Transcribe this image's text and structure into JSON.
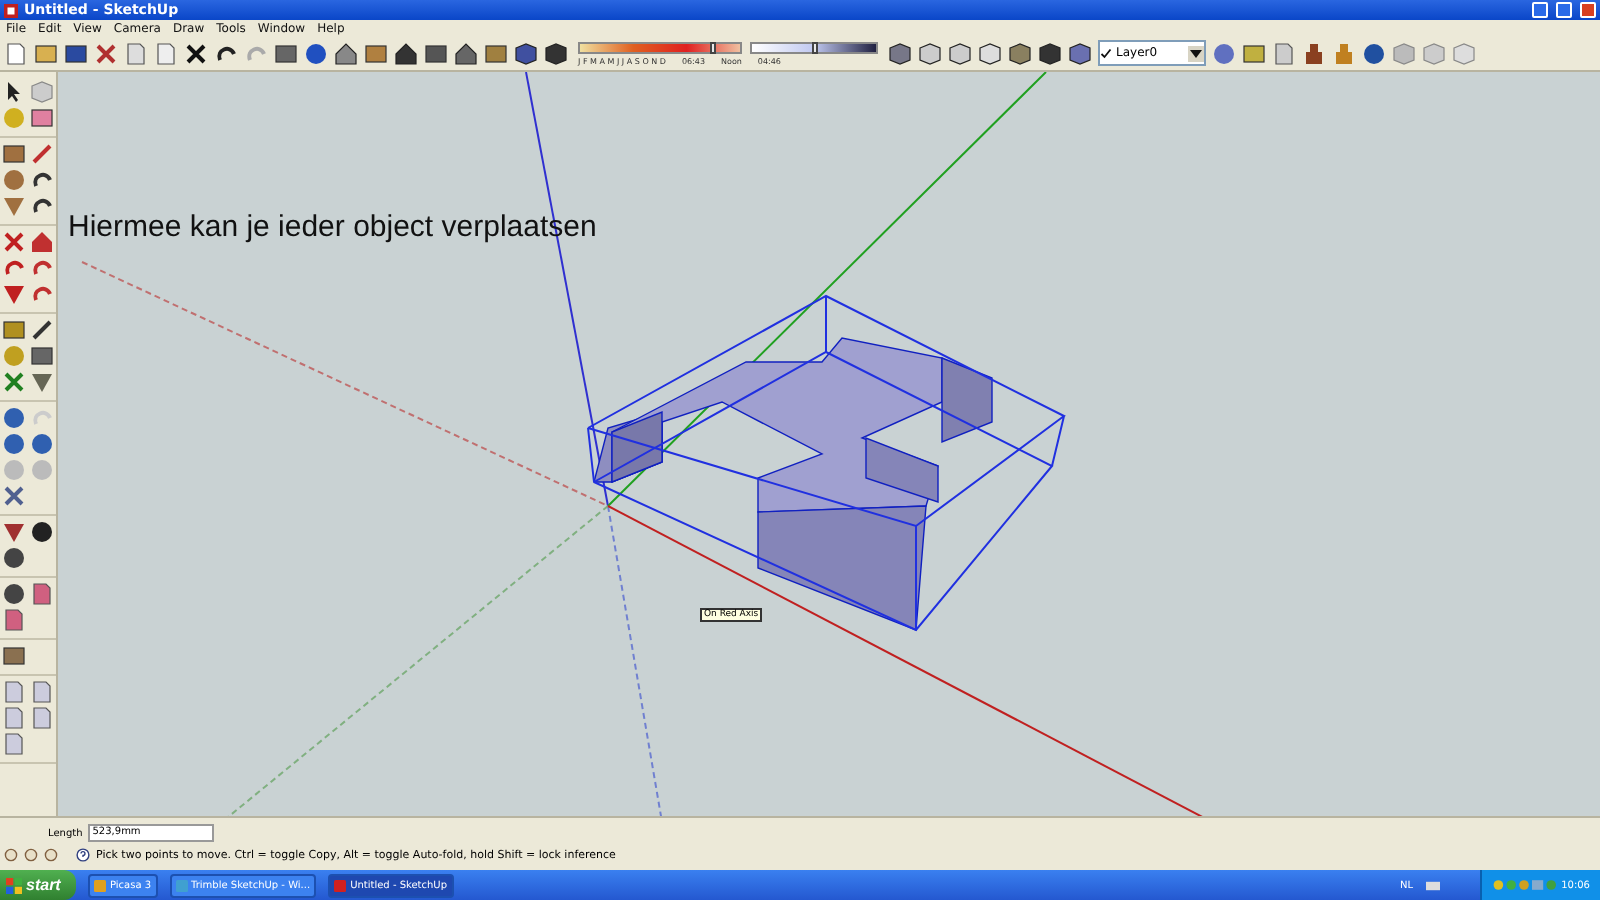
{
  "window": {
    "title": "Untitled - SketchUp"
  },
  "menu": [
    "File",
    "Edit",
    "View",
    "Camera",
    "Draw",
    "Tools",
    "Window",
    "Help"
  ],
  "shadow_settings": {
    "month_slider": {
      "level": 0.82
    },
    "time_slider": {
      "level": 0.5
    },
    "months": "J F M A M J J A S O N D",
    "time_start": "06:43",
    "time_mid": "Noon",
    "time_end": "04:46"
  },
  "layer": {
    "name": "Layer0"
  },
  "canvas": {
    "annotation": "Hiermee kan je ieder object verplaatsen",
    "tooltip": "On Red Axis"
  },
  "measurements": {
    "label": "Length",
    "value": "523,9mm"
  },
  "status": "Pick two points to move.  Ctrl = toggle Copy, Alt = toggle Auto-fold, hold Shift = lock inference",
  "taskbar": {
    "start": "start",
    "items": [
      {
        "label": "Picasa 3",
        "selected": false
      },
      {
        "label": "Trimble SketchUp - Wi...",
        "selected": false
      },
      {
        "label": "Untitled - SketchUp",
        "selected": true
      }
    ],
    "language": "NL",
    "clock": "10:06"
  }
}
